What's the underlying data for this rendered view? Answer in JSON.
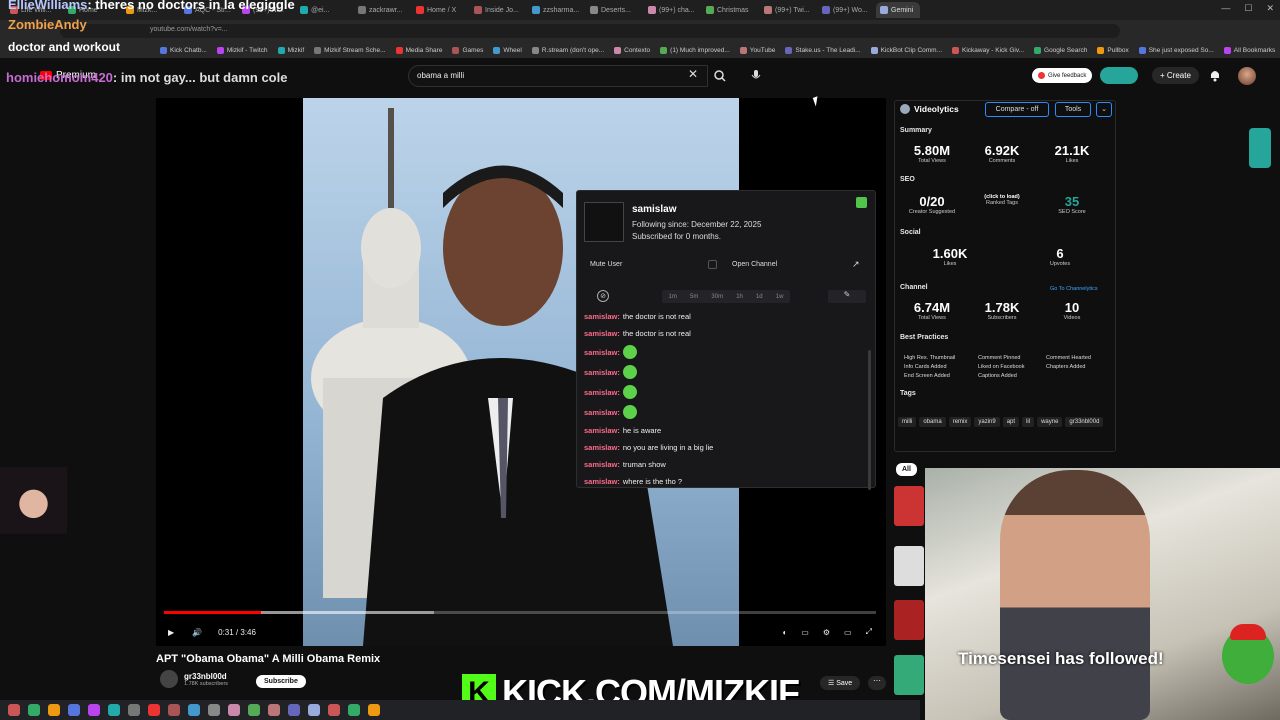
{
  "browser": {
    "tabs": [
      "Life Will...",
      "Home",
      "Mizk...",
      "AQC - Str...",
      "(99+) Ni...",
      "@ei...",
      "zackrawr...",
      "Home / X",
      "Inside Jo...",
      "zzsharma...",
      "Deserts...",
      "(99+) cha...",
      "Christmas",
      "(99+) Twi...",
      "(99+) Wo...",
      "Gemini"
    ],
    "url": "youtube.com/watch?v=...",
    "bookmarks": [
      "Kick Chatb...",
      "Mizkif - Twitch",
      "Mizkif",
      "Mizkif Stream Sche...",
      "Media Share",
      "Games",
      "Wheel",
      "R.stream (don't ope...",
      "Contexto",
      "(1) Much improved...",
      "YouTube",
      "Stake.us - The Leadi...",
      "KickBot Clip Comm...",
      "Kickaway - Kick Giv...",
      "Google Search",
      "Pullbox",
      "She just exposed So...",
      "All Bookmarks"
    ]
  },
  "overlay": {
    "line1_user": "EllieWilliams",
    "line1_text": ": theres no doctors in la elegiggle",
    "line2_user": "ZombieAndy",
    "line3": "doctor and workout",
    "chat_user": "homiehomom420",
    "chat_text": ": im not gay... but damn cole"
  },
  "youtube": {
    "logo_text": "Premium",
    "search_value": "obama a milli",
    "feedback_label": "Give feedback",
    "create_label": "Create",
    "time": "0:31 / 3:46",
    "progress": 0.137,
    "title": "APT \"Obama Obama\" A Milli Obama Remix",
    "channel": "gr33nbl00d",
    "subscribers": "1.78K subscribers",
    "subscribe_label": "Subscribe",
    "save_label": "Save",
    "chip_all": "All"
  },
  "popup": {
    "username": "samislaw",
    "following_since": "Following since: December 22, 2025",
    "subscribed": "Subscribed for 0 months.",
    "mute_label": "Mute User",
    "open_channel": "Open Channel",
    "timeouts": [
      "1m",
      "5m",
      "30m",
      "1h",
      "1d",
      "1w"
    ],
    "messages": [
      {
        "user": "samislaw:",
        "text": "the doctor is not real",
        "emote": false
      },
      {
        "user": "samislaw:",
        "text": "the doctor is not real",
        "emote": false
      },
      {
        "user": "samislaw:",
        "text": "",
        "emote": true
      },
      {
        "user": "samislaw:",
        "text": "",
        "emote": true
      },
      {
        "user": "samislaw:",
        "text": "",
        "emote": true
      },
      {
        "user": "samislaw:",
        "text": "",
        "emote": true
      },
      {
        "user": "samislaw:",
        "text": "he is aware",
        "emote": false
      },
      {
        "user": "samislaw:",
        "text": "no you are living in a big lie",
        "emote": false
      },
      {
        "user": "samislaw:",
        "text": "truman show",
        "emote": false
      },
      {
        "user": "samislaw:",
        "text": "where is the        tho ?",
        "emote": false
      }
    ]
  },
  "videolytics": {
    "name": "Videolytics",
    "compare_label": "Compare - off",
    "tools_label": "Tools",
    "summary_label": "Summary",
    "summary": [
      {
        "v": "5.80M",
        "l": "Total Views"
      },
      {
        "v": "6.92K",
        "l": "Comments"
      },
      {
        "v": "21.1K",
        "l": "Likes"
      }
    ],
    "seo_label": "SEO",
    "seo": [
      {
        "v": "0/20",
        "l": "Creator Suggested"
      },
      {
        "v": "(click to load)",
        "l": "Ranked Tags"
      },
      {
        "v": "35",
        "l": "SEO Score"
      }
    ],
    "social_label": "Social",
    "social": [
      {
        "v": "1.60K",
        "l": "Likes"
      },
      {
        "v": "6",
        "l": "Upvotes"
      }
    ],
    "channel_label": "Channel",
    "channel_link": "Go To Channelytics",
    "channel": [
      {
        "v": "6.74M",
        "l": "Total Views"
      },
      {
        "v": "1.78K",
        "l": "Subscribers"
      },
      {
        "v": "10",
        "l": "Videos"
      }
    ],
    "bp_label": "Best Practices",
    "best_practices": [
      "High Res. Thumbnail",
      "Comment Pinned",
      "Comment Hearted",
      "Info Cards Added",
      "Liked on Facebook",
      "Chapters Added",
      "End Screen Added",
      "Captions Added"
    ],
    "tags_label": "Tags",
    "tags": [
      "milli",
      "obama",
      "remix",
      "yazin9",
      "apt",
      "lil",
      "wayne",
      "gr33nbl00d"
    ]
  },
  "stream": {
    "follow_alert": "Timesensei has followed!",
    "kick_letter": "K",
    "kick_banner": "KICK.COM/MIZKIF"
  },
  "colors": {
    "accent": "#26a69a",
    "kick_green": "#53fc18",
    "yt_red": "#ff0000",
    "chat_user": "#ff6b8b"
  }
}
